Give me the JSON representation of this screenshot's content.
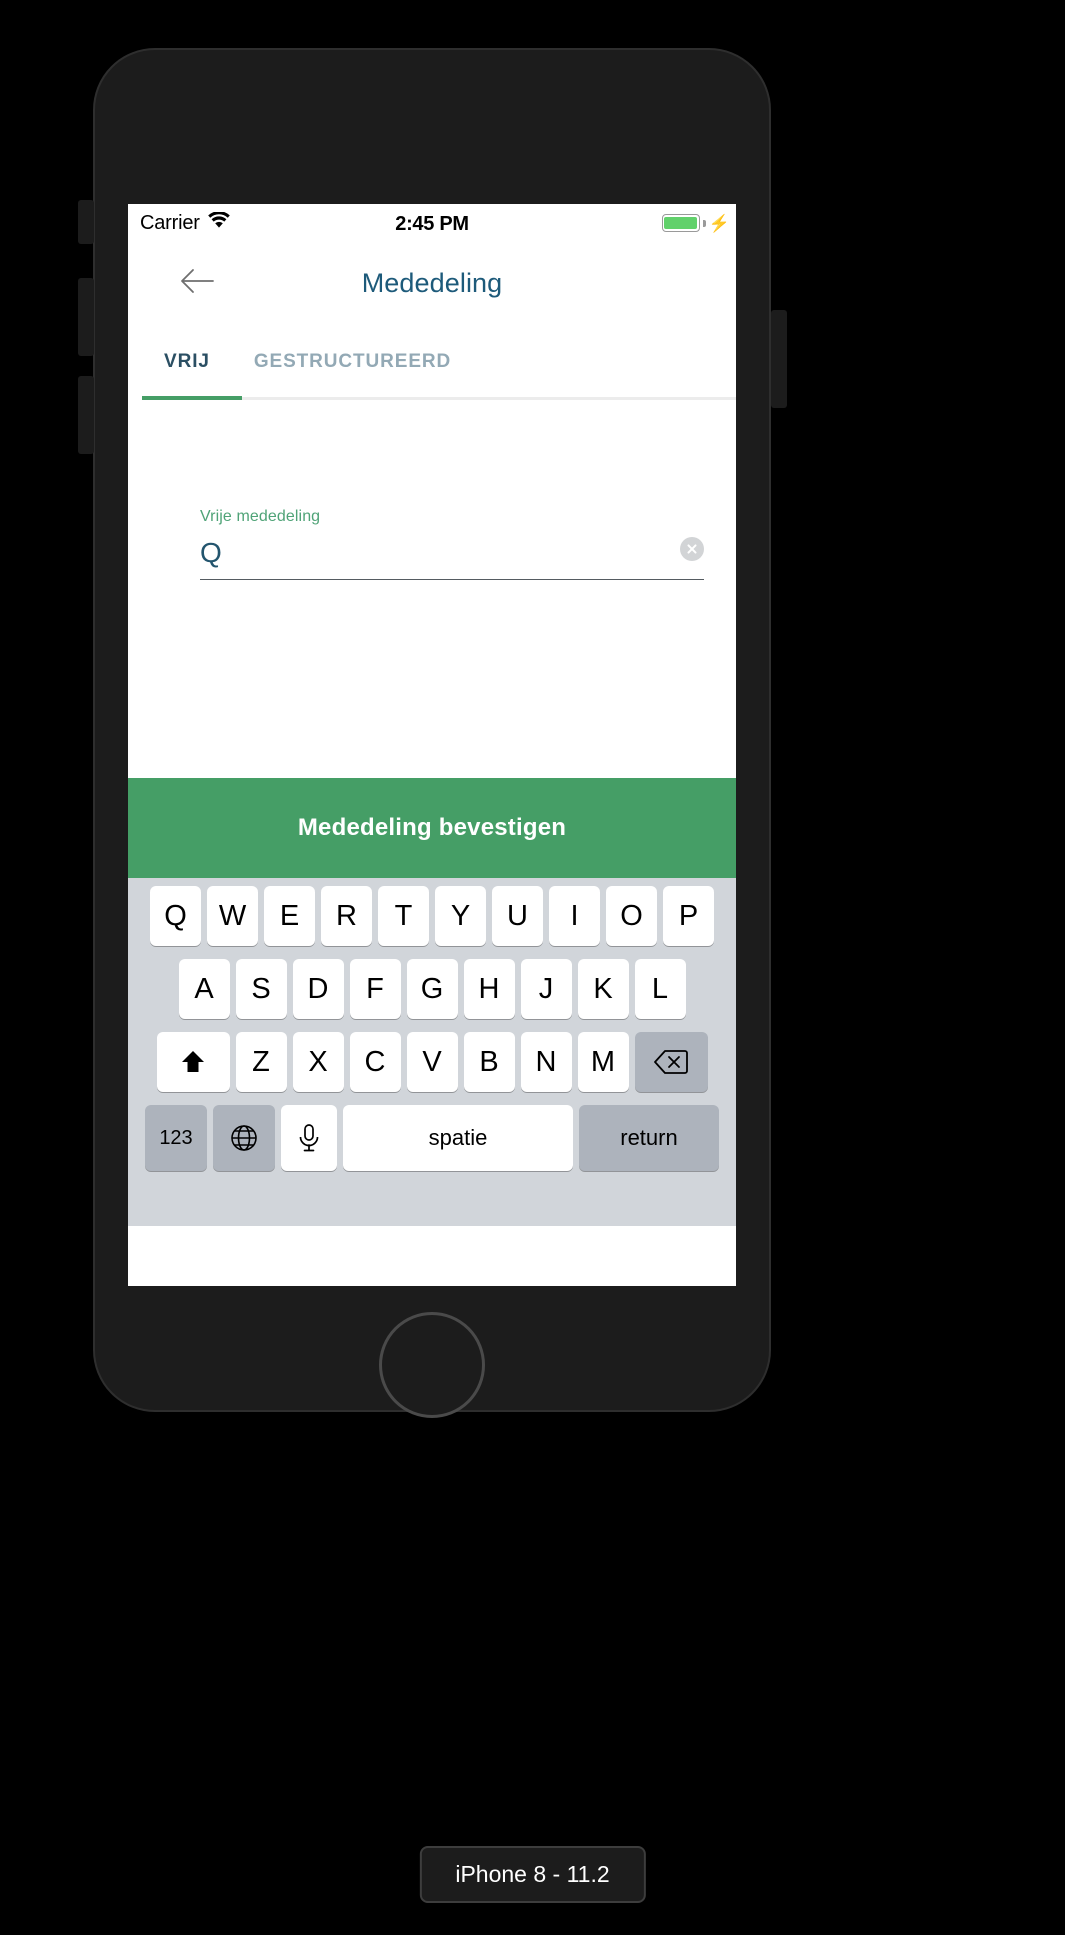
{
  "device": {
    "caption": "iPhone 8 - 11.2"
  },
  "status_bar": {
    "carrier": "Carrier",
    "wifi_icon": "wifi-icon",
    "time": "2:45 PM",
    "battery_icon": "battery-icon",
    "charging_icon": "lightning-bolt-icon",
    "battery_color": "#61d16b"
  },
  "nav_bar": {
    "back_icon": "arrow-left-icon",
    "title": "Mededeling",
    "title_color": "#1d5a7a"
  },
  "tabs": {
    "items": [
      {
        "label": "VRIJ",
        "active": true
      },
      {
        "label": "GESTRUCTUREERD",
        "active": false
      }
    ],
    "active_color": "#2b4f63",
    "inactive_color": "#93a9b5",
    "underline_color": "#459e66"
  },
  "form": {
    "field_label": "Vrije mededeling",
    "field_value": "Q",
    "field_placeholder": "Vrije mededeling",
    "label_color": "#4fa377",
    "value_color": "#23556e",
    "clear_icon": "clear-circle-x-icon"
  },
  "confirm": {
    "label": "Mededeling bevestigen",
    "background": "#459e66",
    "text_color": "#ffffff"
  },
  "keyboard": {
    "background": "#d1d5da",
    "row1": [
      "Q",
      "W",
      "E",
      "R",
      "T",
      "Y",
      "U",
      "I",
      "O",
      "P"
    ],
    "row2": [
      "A",
      "S",
      "D",
      "F",
      "G",
      "H",
      "J",
      "K",
      "L"
    ],
    "row3": [
      "Z",
      "X",
      "C",
      "V",
      "B",
      "N",
      "M"
    ],
    "shift_icon": "shift-arrow-up-icon",
    "backspace_icon": "backspace-delete-icon",
    "numbers_key": "123",
    "globe_icon": "globe-language-icon",
    "mic_icon": "microphone-icon",
    "space_key": "spatie",
    "return_key": "return"
  }
}
